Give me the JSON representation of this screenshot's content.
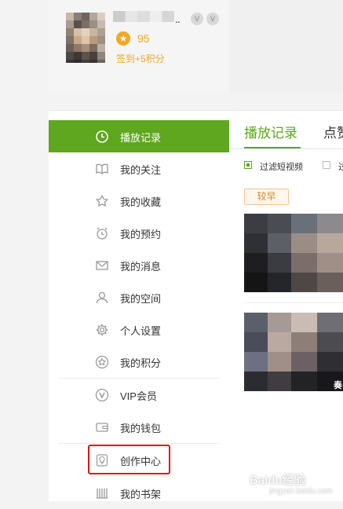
{
  "profile": {
    "username_dots": "..",
    "badge_1": "V",
    "badge_2": "V",
    "points_value": "95",
    "signin_text": "签到+5积分"
  },
  "sidebar": {
    "items": [
      {
        "label": "播放记录",
        "icon": "clock-icon"
      },
      {
        "label": "我的关注",
        "icon": "book-open-icon"
      },
      {
        "label": "我的收藏",
        "icon": "star-icon"
      },
      {
        "label": "我的预约",
        "icon": "alarm-clock-icon"
      },
      {
        "label": "我的消息",
        "icon": "envelope-icon"
      },
      {
        "label": "我的空间",
        "icon": "person-icon"
      },
      {
        "label": "个人设置",
        "icon": "gear-icon"
      },
      {
        "label": "我的积分",
        "icon": "star-circle-icon"
      },
      {
        "label": "VIP会员",
        "icon": "vip-icon"
      },
      {
        "label": "我的钱包",
        "icon": "wallet-icon"
      },
      {
        "label": "创作中心",
        "icon": "lightbulb-icon"
      },
      {
        "label": "我的书架",
        "icon": "bookshelf-icon"
      }
    ]
  },
  "main": {
    "tabs": [
      {
        "label": "播放记录"
      },
      {
        "label": "点赞"
      }
    ],
    "filter_short_video": "过滤短视频",
    "filter_second": "过",
    "period_label": "较早",
    "thumb_caption": "奏"
  },
  "watermark": {
    "title": "Baidu经验",
    "url": "jingyan.baidu.com"
  },
  "colors": {
    "accent_green": "#5ea71e",
    "points_orange": "#f5a623",
    "highlight_red": "#e3141a"
  }
}
